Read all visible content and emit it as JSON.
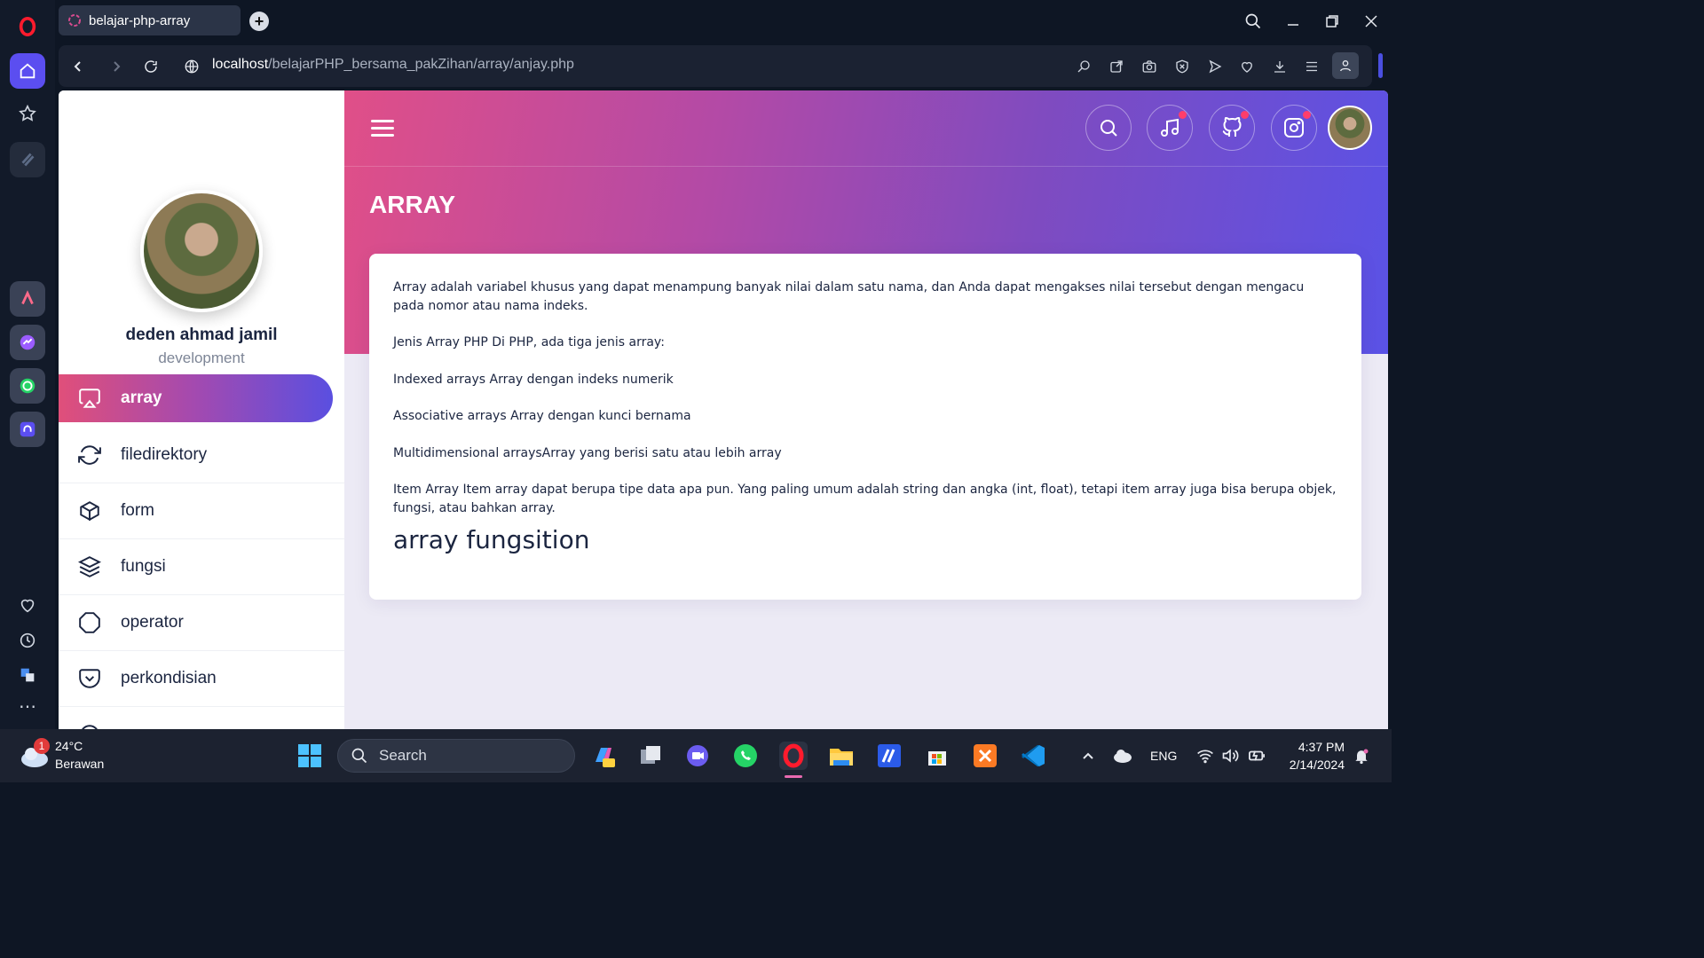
{
  "browser": {
    "tab_title": "belajar-php-array",
    "new_tab": "+",
    "url_host": "localhost",
    "url_path": "/belajarPHP_bersama_pakZihan/array/anjay.php"
  },
  "profile": {
    "name": "deden ahmad jamil",
    "role": "development"
  },
  "menu": [
    {
      "label": "array",
      "icon": "airplay-icon",
      "active": true
    },
    {
      "label": "filedirektory",
      "icon": "refresh-icon",
      "active": false
    },
    {
      "label": "form",
      "icon": "box-icon",
      "active": false
    },
    {
      "label": "fungsi",
      "icon": "layers-icon",
      "active": false
    },
    {
      "label": "operator",
      "icon": "octagon-icon",
      "active": false
    },
    {
      "label": "perkondisian",
      "icon": "pocket-icon",
      "active": false
    }
  ],
  "header": {
    "title": "ARRAY",
    "icons": [
      "search-icon",
      "music-icon",
      "github-icon",
      "instagram-icon"
    ]
  },
  "content": {
    "paragraphs": [
      "Array adalah variabel khusus yang dapat menampung banyak nilai dalam satu nama, dan Anda dapat mengakses nilai tersebut dengan mengacu pada nomor atau nama indeks.",
      "Jenis Array PHP Di PHP, ada tiga jenis array:",
      "Indexed arrays Array dengan indeks numerik",
      "Associative arrays Array dengan kunci bernama",
      "Multidimensional arraysArray yang berisi satu atau lebih array",
      "Item Array Item array dapat berupa tipe data apa pun. Yang paling umum adalah string dan angka (int, float), tetapi item array juga bisa berupa objek, fungsi, atau bahkan array."
    ],
    "heading": "array fungsition"
  },
  "taskbar": {
    "weather_temp": "24°C",
    "weather_desc": "Berawan",
    "weather_badge": "1",
    "search_label": "Search",
    "language": "ENG",
    "time": "4:37 PM",
    "date": "2/14/2024"
  },
  "colors": {
    "accent_start": "#e04f7a",
    "accent_end": "#5a4fe0",
    "text_dark": "#1b2540"
  }
}
